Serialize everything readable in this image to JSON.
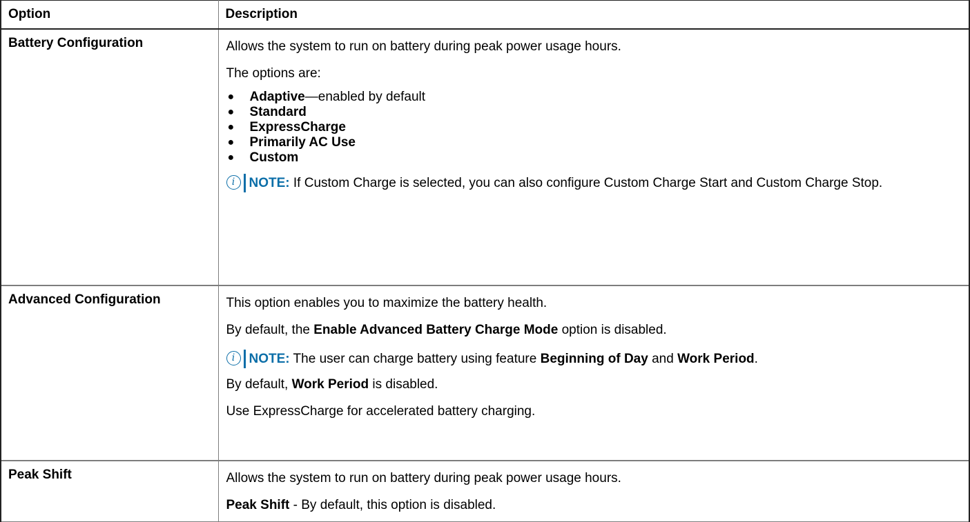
{
  "header": {
    "col_option": "Option",
    "col_description": "Description"
  },
  "rows": [
    {
      "option": "Battery Configuration",
      "p1": "Allows the system to run on battery during peak power usage hours.",
      "p2": "The options are:",
      "bullets": [
        {
          "bold": "Adaptive",
          "rest": "—enabled by default"
        },
        {
          "bold": "Standard",
          "rest": ""
        },
        {
          "bold": "ExpressCharge",
          "rest": ""
        },
        {
          "bold": "Primarily AC Use",
          "rest": ""
        },
        {
          "bold": "Custom",
          "rest": ""
        }
      ],
      "note_label": "NOTE:",
      "note_text": " If Custom Charge is selected, you can also configure Custom Charge Start and Custom Charge Stop."
    },
    {
      "option": "Advanced Configuration",
      "p1": "This option enables you to maximize the battery health.",
      "p2_a": "By default, the ",
      "p2_b": "Enable Advanced Battery Charge Mode",
      "p2_c": " option is disabled.",
      "note_label": "NOTE:",
      "note_a": " The user can charge battery using feature ",
      "note_b": "Beginning of Day",
      "note_c": " and ",
      "note_d": "Work Period",
      "note_e": ".",
      "p3_a": "By default, ",
      "p3_b": "Work Period",
      "p3_c": " is disabled.",
      "p4": "Use ExpressCharge for accelerated battery charging."
    },
    {
      "option": "Peak Shift",
      "p1": "Allows the system to run on battery during peak power usage hours.",
      "p2_a": "Peak Shift",
      "p2_b": " - By default, this option is disabled."
    }
  ],
  "icons": {
    "note": "info-icon",
    "note_glyph": "i"
  },
  "colors": {
    "note_accent": "#0b6ea8",
    "border": "#7d7d7d",
    "border_dark": "#222222"
  }
}
